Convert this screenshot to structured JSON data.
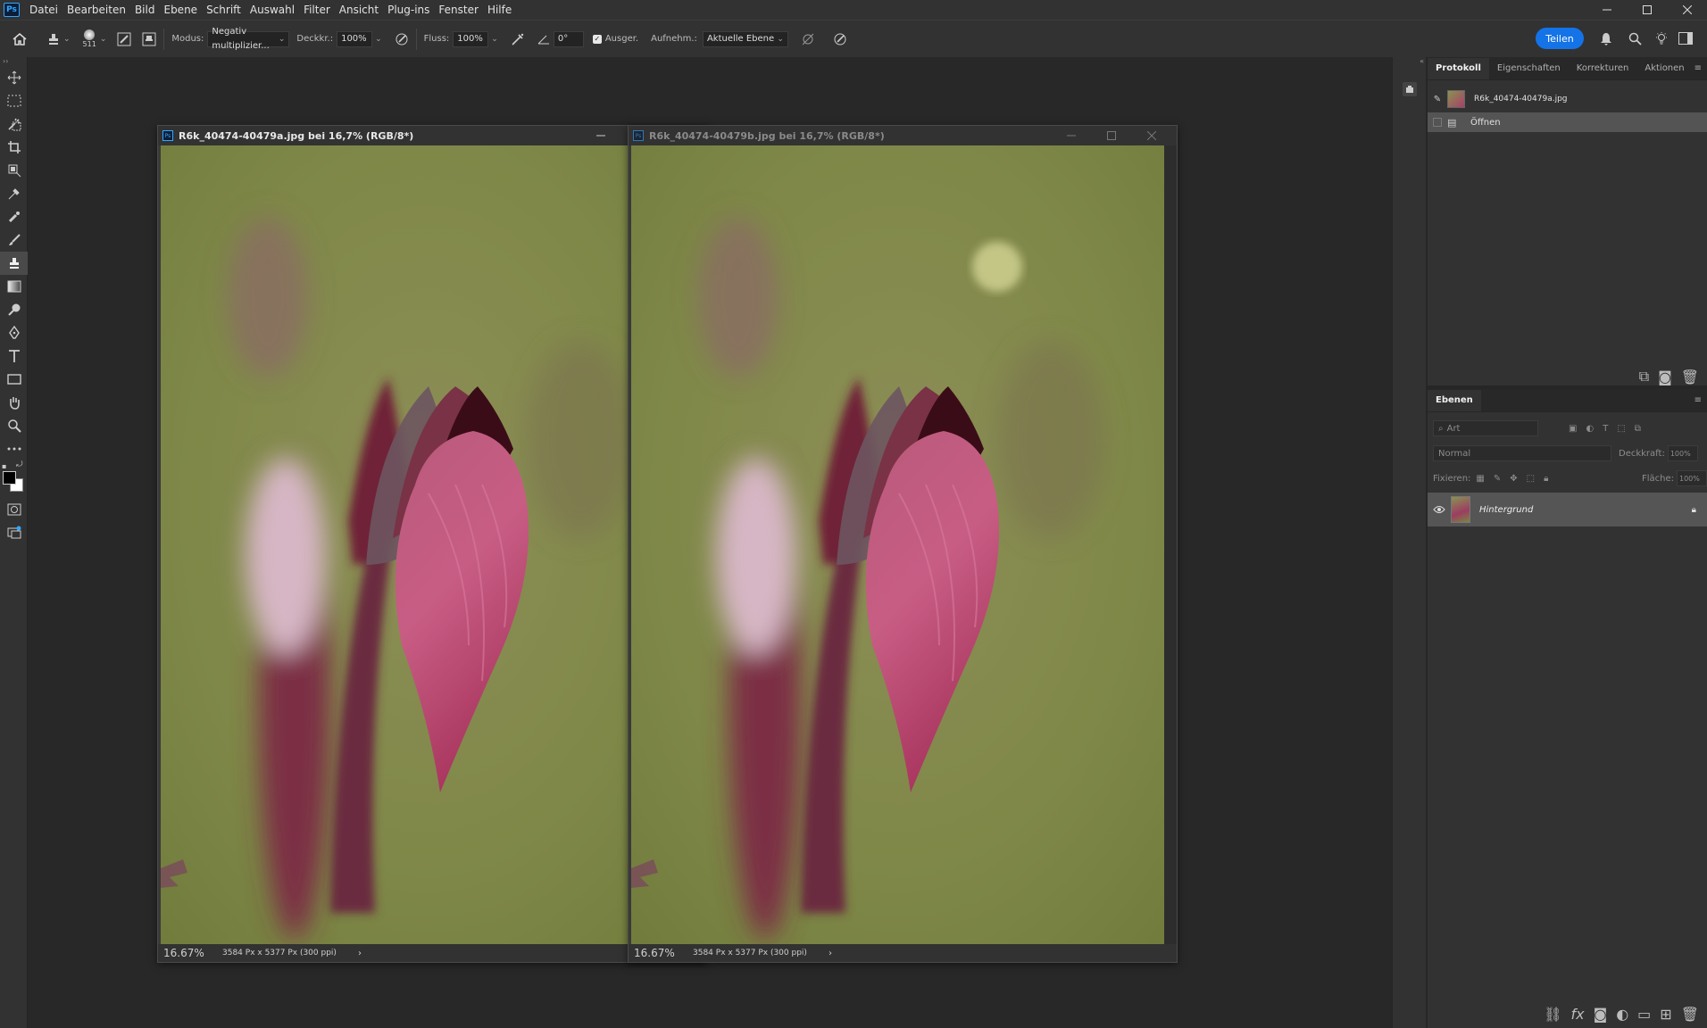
{
  "app": {
    "logo": "Ps"
  },
  "menu": [
    "Datei",
    "Bearbeiten",
    "Bild",
    "Ebene",
    "Schrift",
    "Auswahl",
    "Filter",
    "Ansicht",
    "Plug-ins",
    "Fenster",
    "Hilfe"
  ],
  "options": {
    "brush_size": "511",
    "mode_label": "Modus:",
    "mode_value": "Negativ multiplizier...",
    "opacity_label": "Deckkr.:",
    "opacity_value": "100%",
    "flow_label": "Fluss:",
    "flow_value": "100%",
    "angle_value": "0°",
    "aligned_label": "Ausger.",
    "sample_label": "Aufnehm.:",
    "sample_value": "Aktuelle Ebene",
    "share_label": "Teilen"
  },
  "documents": [
    {
      "title": "R6k_40474-40479a.jpg bei 16,7% (RGB/8*)",
      "zoom": "16.67%",
      "info": "3584 Px x 5377 Px (300 ppi)",
      "active": true
    },
    {
      "title": "R6k_40474-40479b.jpg bei 16,7% (RGB/8*)",
      "zoom": "16.67%",
      "info": "3584 Px x 5377 Px (300 ppi)",
      "active": false
    }
  ],
  "history_panel": {
    "tabs": [
      "Protokoll",
      "Eigenschaften",
      "Korrekturen",
      "Aktionen"
    ],
    "snapshot_name": "R6k_40474-40479a.jpg",
    "states": [
      "Öffnen"
    ]
  },
  "layers_panel": {
    "tab": "Ebenen",
    "filter_placeholder": "Art",
    "blend_mode": "Normal",
    "opacity_label": "Deckkraft:",
    "opacity_value": "100%",
    "lock_label": "Fixieren:",
    "fill_label": "Fläche:",
    "fill_value": "100%",
    "layers": [
      {
        "name": "Hintergrund",
        "visible": true,
        "locked": true
      }
    ]
  },
  "colors": {
    "accent": "#1473e6",
    "chrome": "#323232",
    "canvas_bg": "#282828"
  }
}
